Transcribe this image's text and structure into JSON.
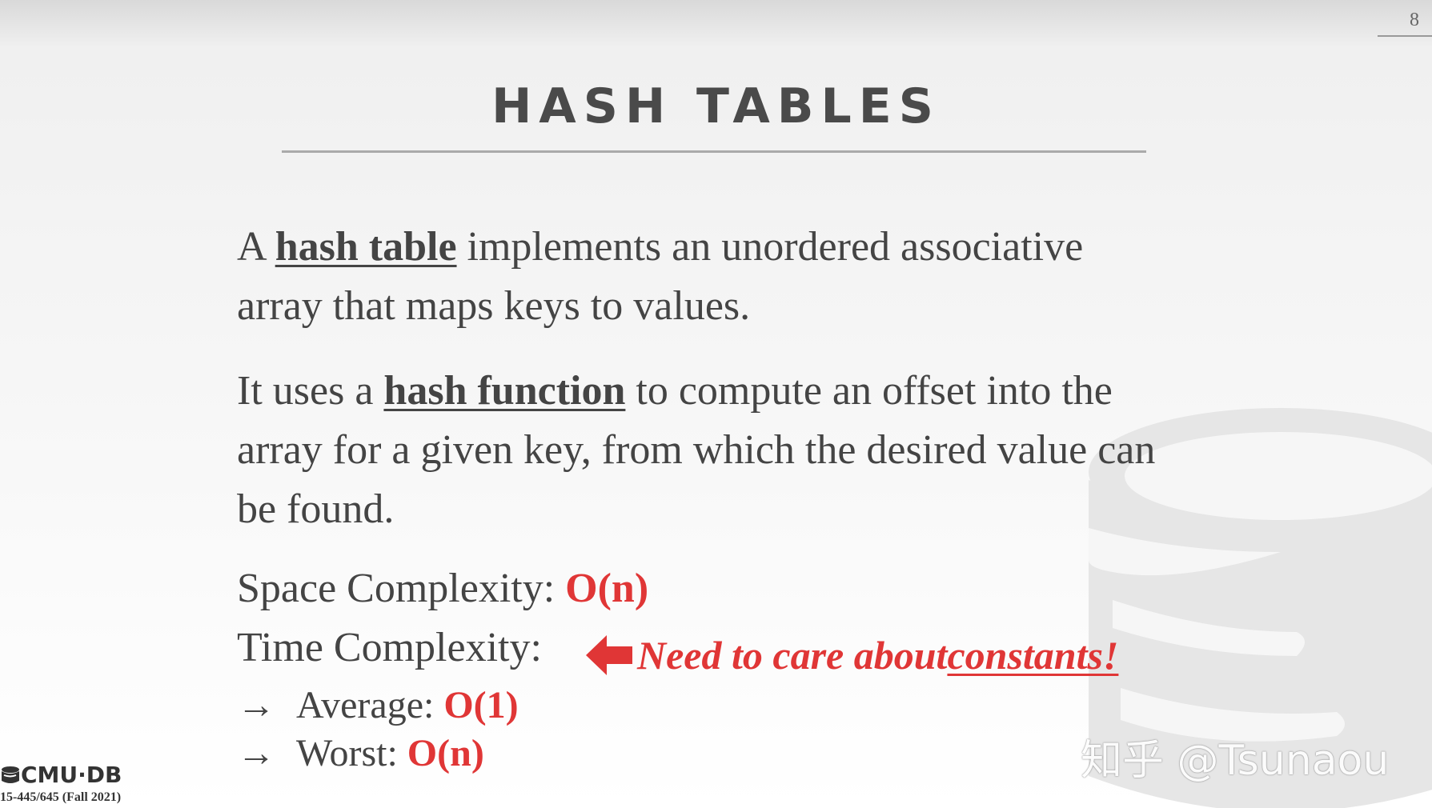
{
  "slide": {
    "page_number": "8",
    "title": "HASH TABLES",
    "para1": {
      "prefix": "A ",
      "term": "hash table",
      "suffix": " implements an unordered associative array that maps keys to values."
    },
    "para2": {
      "prefix": "It uses a ",
      "term": "hash function",
      "suffix": " to compute an offset into the array for a given key, from which the desired value can be found."
    },
    "space": {
      "label": "Space Complexity: ",
      "value": "O(n)"
    },
    "time": {
      "label": "Time Complexity:"
    },
    "note": {
      "text": "Need to care about ",
      "emphasis": "constants!"
    },
    "average": {
      "arrow": "→",
      "label": "Average: ",
      "value": "O(1)"
    },
    "worst": {
      "arrow": "→",
      "label": "Worst: ",
      "value": "O(n)"
    },
    "footer": {
      "logo": "CMU·DB",
      "course": "15-445/645 (Fall 2021)"
    },
    "watermark": "知乎 @Tsunaou",
    "colors": {
      "accent": "#e03636",
      "text": "#444444"
    }
  }
}
